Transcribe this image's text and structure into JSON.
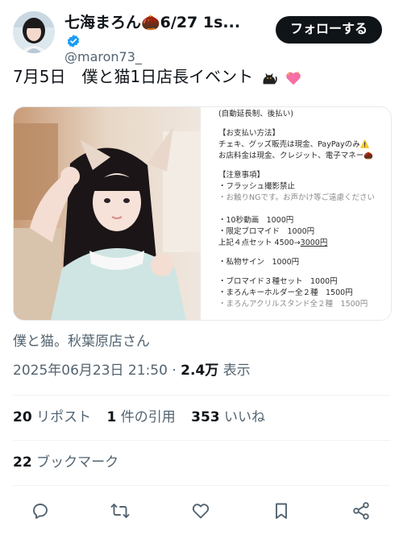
{
  "header": {
    "display_name": "七海まろん🌰6/27 1s...",
    "handle": "@maron73_",
    "follow_label": "フォローする"
  },
  "tweet": {
    "text": "7月5日　僕と猫1日店長イベント"
  },
  "flyer": {
    "upper_lines": [
      "(自動延長制、後払い)",
      "",
      "【お支払い方法】",
      "チェキ、グッズ販売は現金、PayPayのみ⚠️",
      "お店料金は現金、クレジット、電子マネー🌰",
      "",
      "【注意事項】",
      "・フラッシュ撮影禁止",
      "・お触りNGです。お声かけ等ご遠慮ください"
    ],
    "lower_lines": [
      "・10秒動画　1000円",
      "・限定ブロマイド　1000円",
      "上記４点セット 4500→",
      "",
      "・私物サイン　1000円",
      "",
      "・ブロマイド３種セット　1000円",
      "・まろんキーホルダー全２種　1500円",
      "・まろんアクリルスタンド全２種　1500円"
    ],
    "set_price_underlined": "3000円"
  },
  "location": "僕と猫。秋葉原店さん",
  "meta": {
    "timestamp": "2025年06月23日 21:50",
    "separator": "·",
    "views_count": "2.4万",
    "views_label": "表示"
  },
  "stats": {
    "reposts_count": "20",
    "reposts_label": "リポスト",
    "quotes_count": "1",
    "quotes_label": "件の引用",
    "likes_count": "353",
    "likes_label": "いいね",
    "bookmarks_count": "22",
    "bookmarks_label": "ブックマーク"
  },
  "icons": {
    "verified": "verified-badge-icon",
    "reply": "reply-icon",
    "repost": "repost-icon",
    "like": "heart-icon",
    "bookmark": "bookmark-icon",
    "share": "share-icon"
  },
  "colors": {
    "text_primary": "#0f1419",
    "text_secondary": "#536471",
    "verified_blue": "#1d9bf0",
    "follow_bg": "#0f1419",
    "divider": "#eff3f4"
  }
}
